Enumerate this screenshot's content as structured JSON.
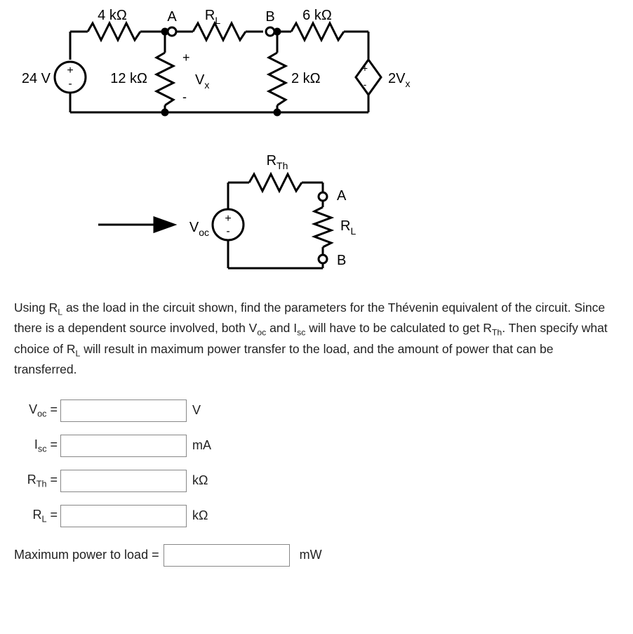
{
  "circuit1": {
    "r_top_left": "4 kΩ",
    "node_a": "A",
    "r_l_top": "R",
    "r_l_top_sub": "L",
    "node_b": "B",
    "r_top_right": "6 kΩ",
    "v_src": "24 V",
    "v_src_pos": "+",
    "v_src_neg": "-",
    "r_12k": "12 kΩ",
    "vx_plus": "+",
    "vx_minus": "-",
    "vx": "V",
    "vx_sub": "x",
    "r_2k": "2 kΩ",
    "dep_src": "2V",
    "dep_src_sub": "x",
    "dep_plus": "+",
    "dep_minus": "-"
  },
  "circuit2": {
    "rth": "R",
    "rth_sub": "Th",
    "voc": "V",
    "voc_sub": "oc",
    "voc_plus": "+",
    "voc_minus": "-",
    "node_a": "A",
    "node_b": "B",
    "rl": "R",
    "rl_sub": "L"
  },
  "problem_text_parts": {
    "p1": "Using R",
    "p1s": "L",
    "p2": " as the load in the circuit shown, find the parameters for the Thévenin equivalent of the circuit. Since there is a dependent source involved, both V",
    "p2s": "oc",
    "p3": " and I",
    "p3s": "sc",
    "p4": " will have to be calculated to get R",
    "p4s": "Th",
    "p5": ". Then specify what choice of R",
    "p5s": "L",
    "p6": " will result in maximum power transfer to the load, and the amount of power that can be transferred."
  },
  "inputs": {
    "voc": {
      "label": "V",
      "label_sub": "oc",
      "eq": " =",
      "unit": "V"
    },
    "isc": {
      "label": "I",
      "label_sub": "sc",
      "eq": " =",
      "unit": "mA"
    },
    "rth": {
      "label": "R",
      "label_sub": "Th",
      "eq": " =",
      "unit": "kΩ"
    },
    "rl": {
      "label": "R",
      "label_sub": "L",
      "eq": " =",
      "unit": "kΩ"
    },
    "pmax": {
      "label": "Maximum power to load =",
      "unit": "mW"
    }
  }
}
